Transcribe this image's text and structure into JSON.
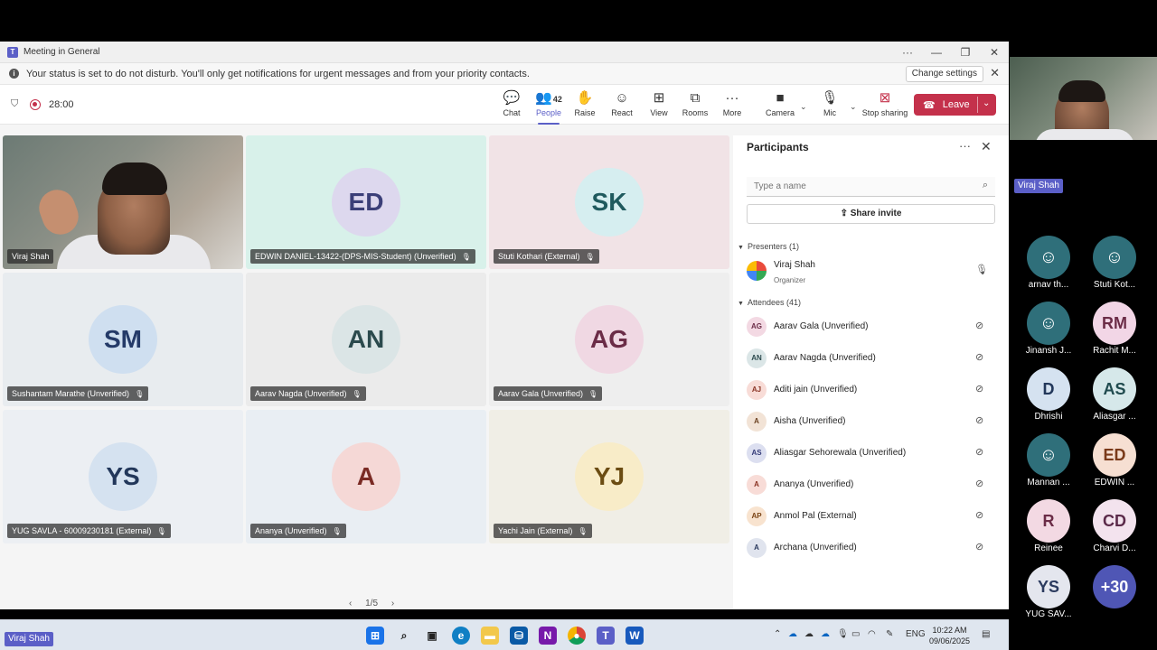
{
  "window": {
    "title": "Meeting in General",
    "minimize": "—",
    "restore": "❐",
    "close": "✕"
  },
  "infobar": {
    "message": "Your status is set to do not disturb. You'll only get notifications for urgent messages and from your priority contacts.",
    "change_settings": "Change settings"
  },
  "toolbar": {
    "timer": "28:00",
    "items": {
      "chat": "Chat",
      "people": "People",
      "people_count": "42",
      "raise": "Raise",
      "react": "React",
      "view": "View",
      "rooms": "Rooms",
      "more": "More",
      "camera": "Camera",
      "mic": "Mic",
      "stop_sharing": "Stop sharing"
    },
    "leave": "Leave"
  },
  "tiles": [
    {
      "name": "Viraj Shah"
    },
    {
      "initials": "ED",
      "name": "EDWIN DANIEL-13422-(DPS-MIS-Student) (Unverified)",
      "bg": "#d8f1ea",
      "avatar_bg": "#ddd8ee",
      "fg": "#3b3f78"
    },
    {
      "initials": "SK",
      "name": "Stuti Kothari (External)",
      "bg": "#f1e3e6",
      "avatar_bg": "#d6eef0",
      "fg": "#1f5a5e"
    },
    {
      "initials": "SM",
      "name": "Sushantam Marathe (Unverified)",
      "bg": "#e8ecef",
      "avatar_bg": "#cfdff0",
      "fg": "#243a68"
    },
    {
      "initials": "AN",
      "name": "Aarav Nagda (Unverified)",
      "bg": "#ebebeb",
      "avatar_bg": "#dbe5e6",
      "fg": "#2b4a4d"
    },
    {
      "initials": "AG",
      "name": "Aarav Gala (Unverified)",
      "bg": "#eeeeee",
      "avatar_bg": "#f0d8e3",
      "fg": "#6b2c47"
    },
    {
      "initials": "YS",
      "name": "YUG SAVLA - 60009230181 (External)",
      "bg": "#eceff3",
      "avatar_bg": "#d5e2f0",
      "fg": "#22375a"
    },
    {
      "initials": "A",
      "name": "Ananya (Unverified)",
      "bg": "#e9eef3",
      "avatar_bg": "#f5d8d6",
      "fg": "#7a2a24"
    },
    {
      "initials": "YJ",
      "name": "Yachi Jain (External)",
      "bg": "#f0eee6",
      "avatar_bg": "#f8ecc8",
      "fg": "#6b4c12"
    }
  ],
  "pager": {
    "label": "1/5",
    "prev": "‹",
    "next": "›"
  },
  "participants": {
    "title": "Participants",
    "search_placeholder": "Type a name",
    "share_invite": "Share invite",
    "presenters_label": "Presenters (1)",
    "presenter": {
      "name": "Viraj Shah",
      "role": "Organizer"
    },
    "attendees_label": "Attendees (41)",
    "attendees": [
      {
        "initials": "AG",
        "name": "Aarav Gala (Unverified)",
        "bg": "#f3d9e3",
        "fg": "#6b2c47"
      },
      {
        "initials": "AN",
        "name": "Aarav Nagda (Unverified)",
        "bg": "#dbe6e7",
        "fg": "#2b4a4d"
      },
      {
        "initials": "AJ",
        "name": "Aditi jain (Unverified)",
        "bg": "#f8dcd7",
        "fg": "#8a3324"
      },
      {
        "initials": "A",
        "name": "Aisha (Unverified)",
        "bg": "#f2e3d6",
        "fg": "#6b4020"
      },
      {
        "initials": "AS",
        "name": "Aliasgar Sehorewala (Unverified)",
        "bg": "#dcdff0",
        "fg": "#333a78"
      },
      {
        "initials": "A",
        "name": "Ananya (Unverified)",
        "bg": "#f8dcd7",
        "fg": "#8a3324"
      },
      {
        "initials": "AP",
        "name": "Anmol Pal (External)",
        "bg": "#f8e3cf",
        "fg": "#7a4314"
      },
      {
        "initials": "A",
        "name": "Archana (Unverified)",
        "bg": "#e0e4ee",
        "fg": "#2b3a5e"
      }
    ]
  },
  "taskbar": {
    "lang": "ENG",
    "time": "10:22 AM",
    "date": "09/06/2025"
  },
  "side": {
    "video_tag": "Viraj Shah",
    "tiles": [
      {
        "initials": "",
        "name": "arnav th...",
        "bg": "#2f6f7a"
      },
      {
        "initials": "",
        "name": "Stuti Kot...",
        "bg": "#2f6f7a"
      },
      {
        "initials": "",
        "name": "Jinansh J...",
        "bg": "#2f6f7a"
      },
      {
        "initials": "RM",
        "name": "Rachit M...",
        "bg": "#f2d6e6",
        "fg": "#6b2c47"
      },
      {
        "initials": "D",
        "name": "Dhrishi",
        "bg": "#d5e2f0",
        "fg": "#22375a"
      },
      {
        "initials": "AS",
        "name": "Aliasgar ...",
        "bg": "#d6e8ea",
        "fg": "#1f4a4e"
      },
      {
        "initials": "",
        "name": "Mannan ...",
        "bg": "#2f6f7a"
      },
      {
        "initials": "ED",
        "name": "EDWIN ...",
        "bg": "#f6dfd2",
        "fg": "#7a3a1a"
      },
      {
        "initials": "R",
        "name": "Reinee",
        "bg": "#f3d9e3",
        "fg": "#6b2c47"
      },
      {
        "initials": "CD",
        "name": "Charvi D...",
        "bg": "#f3e3ee",
        "fg": "#5b2a4a"
      },
      {
        "initials": "YS",
        "name": "YUG SAV...",
        "bg": "#e4e6ee",
        "fg": "#2b3a5e"
      },
      {
        "initials": "+30",
        "name": "",
        "bg": "#4f56b5",
        "fg": "#ffffff"
      }
    ],
    "bottom_tag": "Viraj Shah"
  }
}
